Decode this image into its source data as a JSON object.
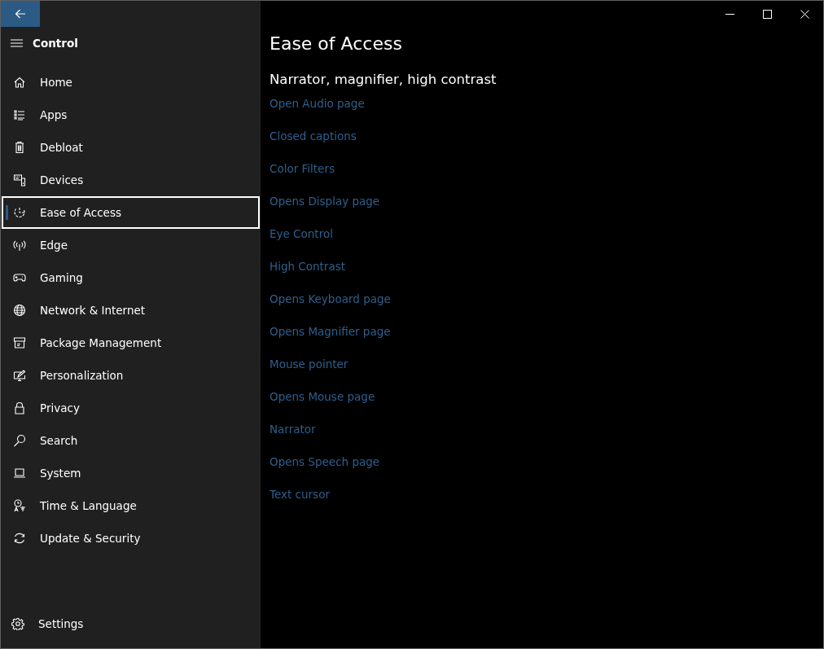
{
  "header": {
    "title": "Control"
  },
  "nav": [
    {
      "label": "Home",
      "selected": false
    },
    {
      "label": "Apps",
      "selected": false
    },
    {
      "label": "Debloat",
      "selected": false
    },
    {
      "label": "Devices",
      "selected": false
    },
    {
      "label": "Ease of Access",
      "selected": true
    },
    {
      "label": "Edge",
      "selected": false
    },
    {
      "label": "Gaming",
      "selected": false
    },
    {
      "label": "Network & Internet",
      "selected": false
    },
    {
      "label": "Package Management",
      "selected": false
    },
    {
      "label": "Personalization",
      "selected": false
    },
    {
      "label": "Privacy",
      "selected": false
    },
    {
      "label": "Search",
      "selected": false
    },
    {
      "label": "System",
      "selected": false
    },
    {
      "label": "Time & Language",
      "selected": false
    },
    {
      "label": "Update & Security",
      "selected": false
    }
  ],
  "footer": {
    "label": "Settings"
  },
  "page": {
    "title": "Ease of Access",
    "subtitle": "Narrator, magnifier, high contrast",
    "links": [
      "Open Audio page",
      "Closed captions",
      "Color Filters",
      "Opens Display page",
      "Eye Control",
      "High Contrast",
      "Opens Keyboard page",
      "Opens Magnifier page",
      "Mouse pointer",
      "Opens Mouse page",
      "Narrator",
      "Opens Speech page",
      "Text cursor"
    ]
  }
}
